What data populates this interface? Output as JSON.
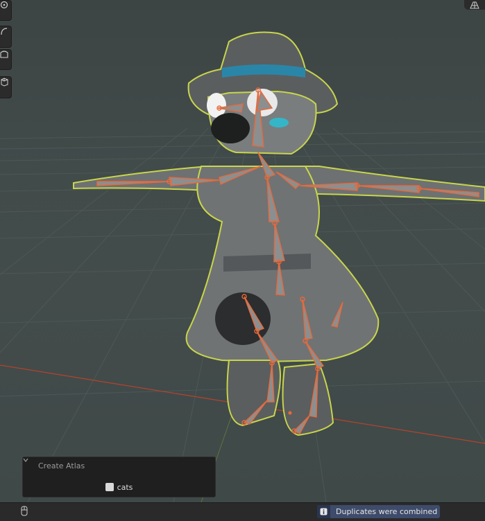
{
  "viewport": {
    "tools": [
      "rotate-view-icon",
      "curve-tool-icon",
      "measure-tool-icon",
      "add-cube-icon"
    ],
    "gizmo_icon": "grid-gizmo-icon"
  },
  "redo_panel": {
    "title": "Create Atlas",
    "checkbox_label": "cats",
    "checkbox_checked": true
  },
  "statusbar": {
    "mouse_icon": "mouse-icon",
    "report_icon": "info-icon",
    "report_text": "Duplicates were combined"
  },
  "colors": {
    "viewport_bg": "#414b4a",
    "selection_outline": "#c9d64b",
    "armature_bones": "#e8693a",
    "x_axis": "#b0432e",
    "report_bg": "#3e4b6a"
  }
}
